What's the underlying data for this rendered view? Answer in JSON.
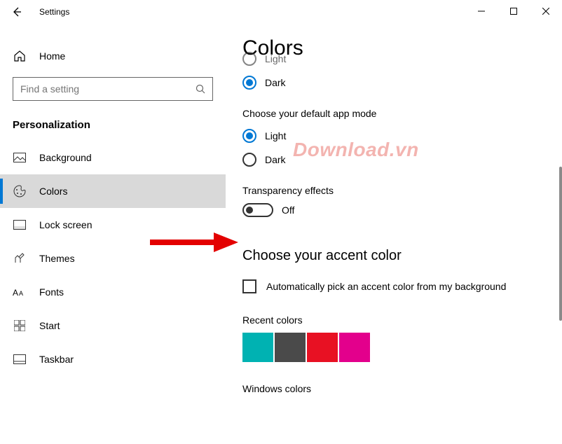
{
  "titlebar": {
    "title": "Settings"
  },
  "sidebar": {
    "home_label": "Home",
    "search_placeholder": "Find a setting",
    "section_title": "Personalization",
    "items": [
      {
        "label": "Background"
      },
      {
        "label": "Colors"
      },
      {
        "label": "Lock screen"
      },
      {
        "label": "Themes"
      },
      {
        "label": "Fonts"
      },
      {
        "label": "Start"
      },
      {
        "label": "Taskbar"
      }
    ]
  },
  "content": {
    "page_title": "Colors",
    "windows_mode": {
      "light_label": "Light",
      "dark_label": "Dark",
      "selected": "dark"
    },
    "app_mode_heading": "Choose your default app mode",
    "app_mode": {
      "light_label": "Light",
      "dark_label": "Dark",
      "selected": "light"
    },
    "transparency_heading": "Transparency effects",
    "transparency_state": "Off",
    "accent_heading": "Choose your accent color",
    "auto_pick_label": "Automatically pick an accent color from my background",
    "auto_pick_checked": false,
    "recent_colors_label": "Recent colors",
    "recent_colors": [
      "#00b2b2",
      "#4a4a4a",
      "#e81123",
      "#e3008c"
    ],
    "windows_colors_label": "Windows colors"
  },
  "watermark": "Download.vn"
}
